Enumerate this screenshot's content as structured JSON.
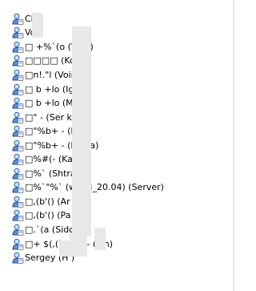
{
  "users": {
    "items": [
      {
        "label": "Ch",
        "icon": "user-icon"
      },
      {
        "label": "Vol",
        "icon": "user-icon"
      },
      {
        "label": "□ +%`(o (Vo         a)",
        "icon": "user-icon"
      },
      {
        "label": "□□□□ (Ko           )",
        "icon": "user-icon"
      },
      {
        "label": "□n!.\"l  (Voin       h)",
        "icon": "user-icon"
      },
      {
        "label": "□ b +lo (Ign      a)",
        "icon": "user-icon"
      },
      {
        "label": "□ b +lo (Ma      a)",
        "icon": "user-icon"
      },
      {
        "label": "□\" - (Ser         kov)",
        "icon": "user-icon"
      },
      {
        "label": "□\"%b+ - (K         a)",
        "icon": "user-icon"
      },
      {
        "label": "□\"%b+ - (L         tina)",
        "icon": "user-icon"
      },
      {
        "label": "□%#(- (Ka         a)",
        "icon": "user-icon"
      },
      {
        "label": "□%`  (Shtra         rg)",
        "icon": "user-icon"
      },
      {
        "label": "□%`\"%` (w2k3_20.04) (Server)",
        "icon": "user-icon"
      },
      {
        "label": "□,(b'() (Ar        o)",
        "icon": "user-icon"
      },
      {
        "label": "□,(b'() (Pa        v)",
        "icon": "user-icon"
      },
      {
        "label": "□.`(a (Sido        )",
        "icon": "user-icon"
      },
      {
        "label": "□+ $(,(`  □c*(- (L      n)",
        "icon": "user-icon"
      },
      {
        "label": "Sergey (H        )",
        "icon": "user-icon"
      }
    ]
  },
  "colors": {
    "background": "#ffffff",
    "redaction": "#e8e8e8",
    "scrollbar_edge": "#ece9d8"
  }
}
